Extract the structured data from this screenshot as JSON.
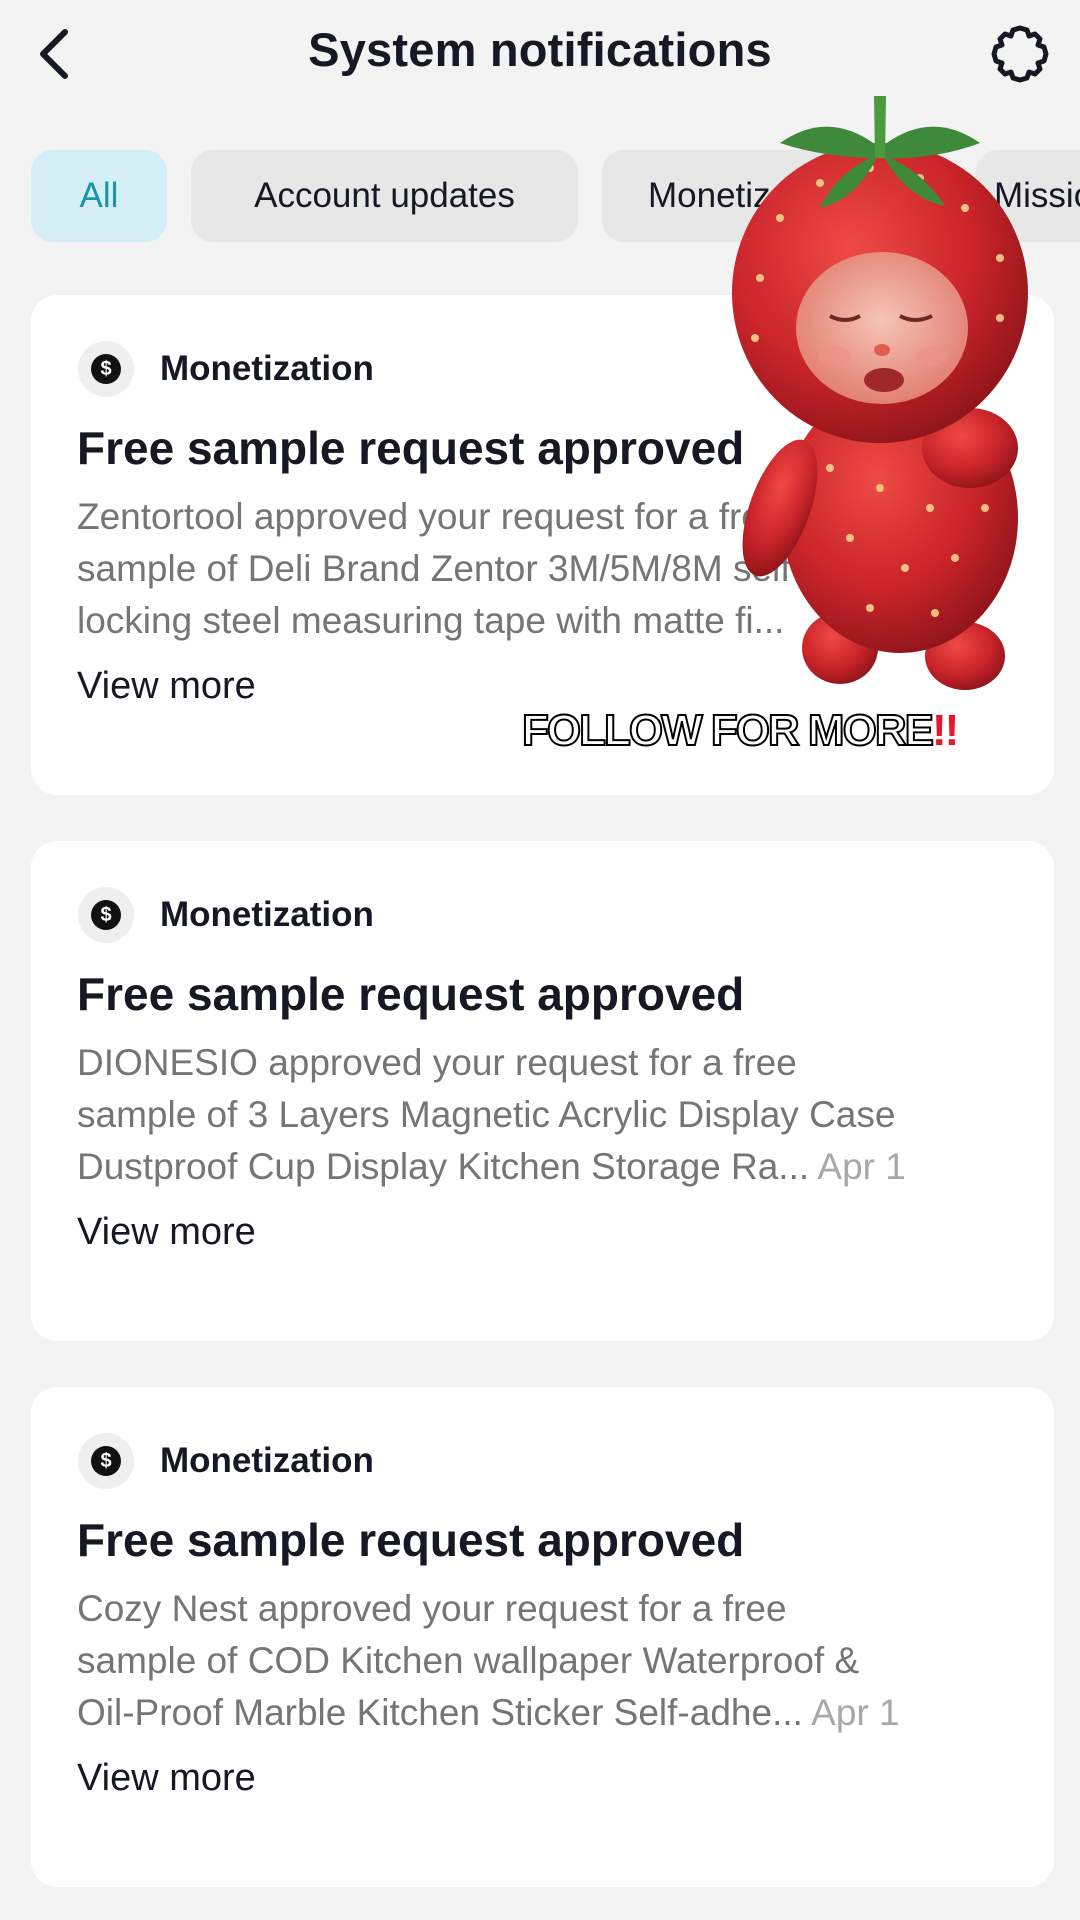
{
  "header": {
    "title": "System notifications"
  },
  "tabs": [
    {
      "label": "All",
      "active": true
    },
    {
      "label": "Account updates",
      "active": false
    },
    {
      "label": "Monetization",
      "active": false
    },
    {
      "label": "Missions",
      "active": false
    }
  ],
  "notifications": [
    {
      "category": "Monetization",
      "title": "Free sample request approved",
      "body_lines": [
        "Zentortool approved your request for a free",
        "sample of Deli Brand Zentor 3M/5M/8M self-",
        "locking steel measuring tape with matte fi..."
      ],
      "date": "",
      "view_more": "View more"
    },
    {
      "category": "Monetization",
      "title": "Free sample request approved",
      "body_lines": [
        "DIONESIO approved your request for a free",
        "sample of 3 Layers Magnetic Acrylic Display Case",
        "Dustproof Cup Display Kitchen Storage Ra..."
      ],
      "date": "Apr 1",
      "view_more": "View more"
    },
    {
      "category": "Monetization",
      "title": "Free sample request approved",
      "body_lines": [
        "Cozy Nest approved your request for a free",
        "sample of COD Kitchen wallpaper Waterproof &",
        "Oil-Proof Marble Kitchen Sticker Self-adhe..."
      ],
      "date": "Apr 1",
      "view_more": "View more"
    }
  ],
  "overlay": {
    "sticker": "strawberry-character",
    "caption": "FOLLOW FOR MORE",
    "caption_suffix": "!!"
  },
  "colors": {
    "background": "#f3f3f3",
    "active_tab_bg": "#d3eef4",
    "active_tab_text": "#1a94ab",
    "tab_bg": "#e7e7e8",
    "card_bg": "#ffffff",
    "body_text": "#757575",
    "strawberry": "#c8242a"
  }
}
